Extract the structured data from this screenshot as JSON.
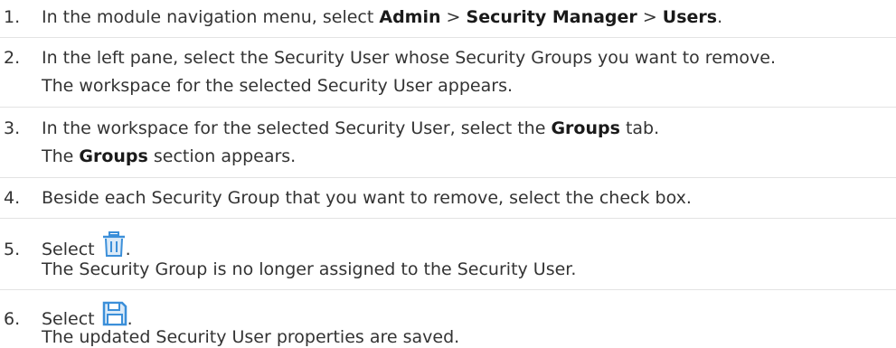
{
  "steps": [
    {
      "number": "1.",
      "text_before": "In the module navigation menu, select ",
      "bold1": "Admin",
      "sep1": " > ",
      "bold2": "Security Manager",
      "sep2": " > ",
      "bold3": "Users",
      "text_after": "."
    },
    {
      "number": "2.",
      "line1": "In the left pane, select the Security User whose Security Groups you want to remove.",
      "line2": "The workspace for the selected Security User appears."
    },
    {
      "number": "3.",
      "text_before": "In the workspace for the selected Security User, select the ",
      "bold": "Groups",
      "text_after": " tab.",
      "line2_before": "The ",
      "line2_bold": "Groups",
      "line2_after": " section appears."
    },
    {
      "number": "4.",
      "line1": "Beside each Security Group that you want to remove, select the check box."
    },
    {
      "number": "5.",
      "text_before": "Select ",
      "icon": "trash-icon",
      "text_after": ".",
      "line2": "The Security Group is no longer assigned to the Security User."
    },
    {
      "number": "6.",
      "text_before": "Select ",
      "icon": "save-icon",
      "text_after": ".",
      "line2": "The updated Security User properties are saved."
    }
  ],
  "colors": {
    "text": "#333333",
    "icon_blue": "#3b8fd9",
    "separator": "#e3e3e3"
  }
}
